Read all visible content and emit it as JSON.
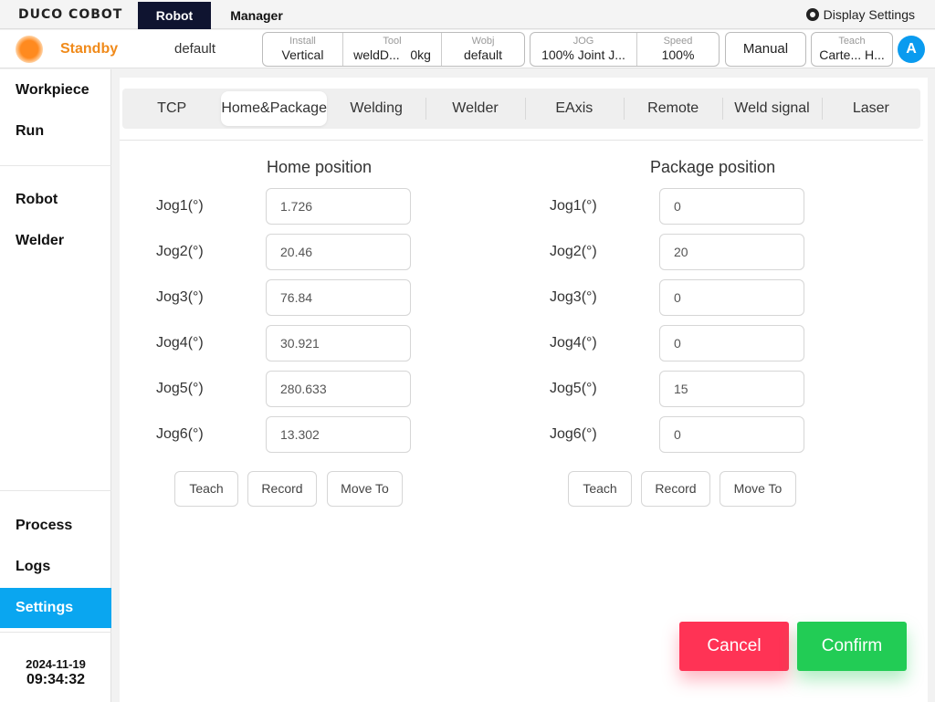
{
  "topbar": {
    "logo": "DUCO COBOT",
    "tabs": [
      {
        "label": "Robot"
      },
      {
        "label": "Manager"
      }
    ],
    "display_settings": "Display Settings"
  },
  "status": {
    "state": "Standby",
    "project": "default",
    "install": {
      "caption": "Install",
      "value": "Vertical"
    },
    "tool": {
      "caption": "Tool",
      "value": "weldD...",
      "weight": "0kg"
    },
    "wobj": {
      "caption": "Wobj",
      "value": "default"
    },
    "jog": {
      "caption": "JOG",
      "value": "100% Joint J..."
    },
    "speed": {
      "caption": "Speed",
      "value": "100%"
    },
    "mode": "Manual",
    "teach": {
      "caption": "Teach",
      "value": "Carte... H..."
    },
    "avatar": "A"
  },
  "sidebar": {
    "items": [
      {
        "label": "Workpiece"
      },
      {
        "label": "Run"
      },
      {
        "label": "Robot"
      },
      {
        "label": "Welder"
      },
      {
        "label": "Process"
      },
      {
        "label": "Logs"
      },
      {
        "label": "Settings"
      }
    ],
    "date": "2024-11-19",
    "time": "09:34:32"
  },
  "tabs": [
    {
      "label": "TCP"
    },
    {
      "label": "Home&Package"
    },
    {
      "label": "Welding"
    },
    {
      "label": "Welder"
    },
    {
      "label": "EAxis"
    },
    {
      "label": "Remote"
    },
    {
      "label": "Weld signal"
    },
    {
      "label": "Laser"
    }
  ],
  "home": {
    "title": "Home position",
    "rows": [
      {
        "label": "Jog1(°)",
        "value": "1.726"
      },
      {
        "label": "Jog2(°)",
        "value": "20.46"
      },
      {
        "label": "Jog3(°)",
        "value": "76.84"
      },
      {
        "label": "Jog4(°)",
        "value": "30.921"
      },
      {
        "label": "Jog5(°)",
        "value": "280.633"
      },
      {
        "label": "Jog6(°)",
        "value": "13.302"
      }
    ],
    "buttons": {
      "teach": "Teach",
      "record": "Record",
      "move_to": "Move To"
    }
  },
  "package": {
    "title": "Package position",
    "rows": [
      {
        "label": "Jog1(°)",
        "value": "0"
      },
      {
        "label": "Jog2(°)",
        "value": "20"
      },
      {
        "label": "Jog3(°)",
        "value": "0"
      },
      {
        "label": "Jog4(°)",
        "value": "0"
      },
      {
        "label": "Jog5(°)",
        "value": "15"
      },
      {
        "label": "Jog6(°)",
        "value": "0"
      }
    ],
    "buttons": {
      "teach": "Teach",
      "record": "Record",
      "move_to": "Move To"
    }
  },
  "actions": {
    "cancel": "Cancel",
    "confirm": "Confirm"
  },
  "colors": {
    "accent": "#0aa6f0",
    "status": "#f08a1a",
    "cancel": "#ff3355",
    "confirm": "#22cc55",
    "active_tab_top": "#0f1430"
  }
}
